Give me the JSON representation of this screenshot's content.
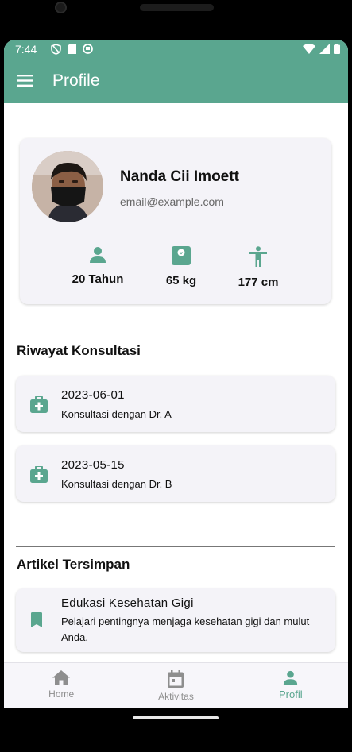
{
  "status_bar": {
    "time": "7:44"
  },
  "app_bar": {
    "title": "Profile"
  },
  "profile": {
    "name": "Nanda Cii Imoett",
    "email": "email@example.com",
    "stats": [
      {
        "icon": "person-icon",
        "value": "20 Tahun"
      },
      {
        "icon": "scale-icon",
        "value": "65 kg"
      },
      {
        "icon": "height-icon",
        "value": "177 cm"
      }
    ]
  },
  "consultations": {
    "title": "Riwayat Konsultasi",
    "items": [
      {
        "date": "2023-06-01",
        "desc": "Konsultasi dengan Dr. A"
      },
      {
        "date": "2023-05-15",
        "desc": "Konsultasi dengan Dr. B"
      }
    ]
  },
  "articles": {
    "title": "Artikel Tersimpan",
    "items": [
      {
        "title": "Edukasi Kesehatan Gigi",
        "desc": "Pelajari pentingnya menjaga kesehatan gigi dan mulut Anda."
      }
    ]
  },
  "bottom_nav": {
    "items": [
      {
        "label": "Home",
        "icon": "home-icon"
      },
      {
        "label": "Aktivitas",
        "icon": "calendar-icon"
      },
      {
        "label": "Profil",
        "icon": "person-icon"
      }
    ],
    "active": "Profil"
  },
  "colors": {
    "primary": "#5aa68f",
    "card": "#f4f3f8"
  }
}
